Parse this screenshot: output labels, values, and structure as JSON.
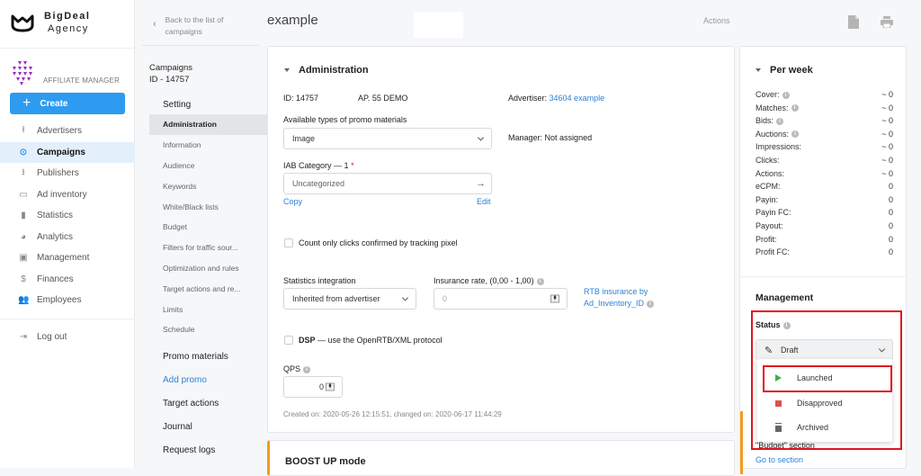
{
  "brand": {
    "line1": "BigDeal",
    "line2": "Agency",
    "role": "AFFILIATE MANAGER"
  },
  "sidebar": {
    "create_label": "Create",
    "items": [
      {
        "label": "Advertisers",
        "icon": "upload-icon"
      },
      {
        "label": "Campaigns",
        "icon": "play-circle-icon",
        "active": true
      },
      {
        "label": "Publishers",
        "icon": "download-icon"
      },
      {
        "label": "Ad inventory",
        "icon": "window-icon"
      },
      {
        "label": "Statistics",
        "icon": "bar-chart-icon"
      },
      {
        "label": "Analytics",
        "icon": "pie-chart-icon"
      },
      {
        "label": "Management",
        "icon": "gear-box-icon"
      },
      {
        "label": "Finances",
        "icon": "dollar-icon"
      },
      {
        "label": "Employees",
        "icon": "people-icon"
      }
    ],
    "logout_label": "Log out"
  },
  "subnav": {
    "back_line1": "Back to the list of",
    "back_line2": "campaigns",
    "title_line1": "Campaigns",
    "title_line2": "ID - 14757",
    "setting_label": "Setting",
    "setting_items": [
      "Administration",
      "Information",
      "Audience",
      "Keywords",
      "White/Black lists",
      "Budget",
      "Filters for traffic sour...",
      "Optimization and rules",
      "Target actions and re...",
      "Limits",
      "Schedule"
    ],
    "promo_label": "Promo materials",
    "add_promo_label": "Add promo",
    "target_actions_label": "Target actions",
    "journal_label": "Journal",
    "request_logs_label": "Request logs"
  },
  "header": {
    "title": "example",
    "actions_label": "Actions"
  },
  "admin": {
    "title": "Administration",
    "id_text": "ID: 14757",
    "ap_text": "AP. 55 DEMO",
    "advertiser_label": "Advertiser:",
    "advertiser_link": "34604 example",
    "promo_types_label": "Available types of promo materials",
    "promo_types_value": "Image",
    "manager_label": "Manager:",
    "manager_value": "Not assigned",
    "iab_label": "IAB Category — 1",
    "iab_required": "*",
    "iab_value": "Uncategorized",
    "copy_label": "Copy",
    "edit_label": "Edit",
    "count_clicks_label": "Count only clicks confirmed by tracking pixel",
    "stats_integration_label": "Statistics integration",
    "stats_integration_value": "Inherited from advertiser",
    "insurance_label": "Insurance rate, (0,00 - 1,00)",
    "insurance_placeholder": "0",
    "rtb_link_line1": "RTB insurance by",
    "rtb_link_line2": "Ad_Inventory_ID",
    "dsp_bold": "DSP",
    "dsp_rest": " — use the OpenRTB/XML protocol",
    "qps_label": "QPS",
    "qps_value": "0",
    "created_text": "Created on: 2020-05-26 12:15:51, changed on: 2020-06-17 11:44:29"
  },
  "boost": {
    "title": "BOOST UP mode"
  },
  "per_week": {
    "title": "Per week",
    "rows": [
      {
        "label": "Cover:",
        "value": "~ 0",
        "info": true
      },
      {
        "label": "Matches:",
        "value": "~ 0",
        "info": true
      },
      {
        "label": "Bids:",
        "value": "~ 0",
        "info": true
      },
      {
        "label": "Auctions:",
        "value": "~ 0",
        "info": true
      },
      {
        "label": "Impressions:",
        "value": "~ 0"
      },
      {
        "label": "Clicks:",
        "value": "~ 0"
      },
      {
        "label": "Actions:",
        "value": "~ 0"
      },
      {
        "label": "eCPM:",
        "value": "0"
      },
      {
        "label": "Payin:",
        "value": "0"
      },
      {
        "label": "Payin FC:",
        "value": "0"
      },
      {
        "label": "Payout:",
        "value": "0"
      },
      {
        "label": "Profit:",
        "value": "0"
      },
      {
        "label": "Profit FC:",
        "value": "0"
      }
    ]
  },
  "management": {
    "title": "Management",
    "status_label": "Status",
    "status_value": "Draft",
    "options": [
      {
        "label": "Launched",
        "icon": "play-icon",
        "color": "#3cb34a"
      },
      {
        "label": "Disapproved",
        "icon": "stop-square-icon",
        "color": "#e05050"
      },
      {
        "label": "Archived",
        "icon": "trash-icon",
        "color": "#666666"
      }
    ],
    "budget_note": "\"Budget\" section",
    "goto_label": "Go to section"
  },
  "colors": {
    "accent": "#2d9bf0",
    "link": "#2d83d6",
    "highlight": "#e0141f",
    "boost": "#f39c1f"
  }
}
